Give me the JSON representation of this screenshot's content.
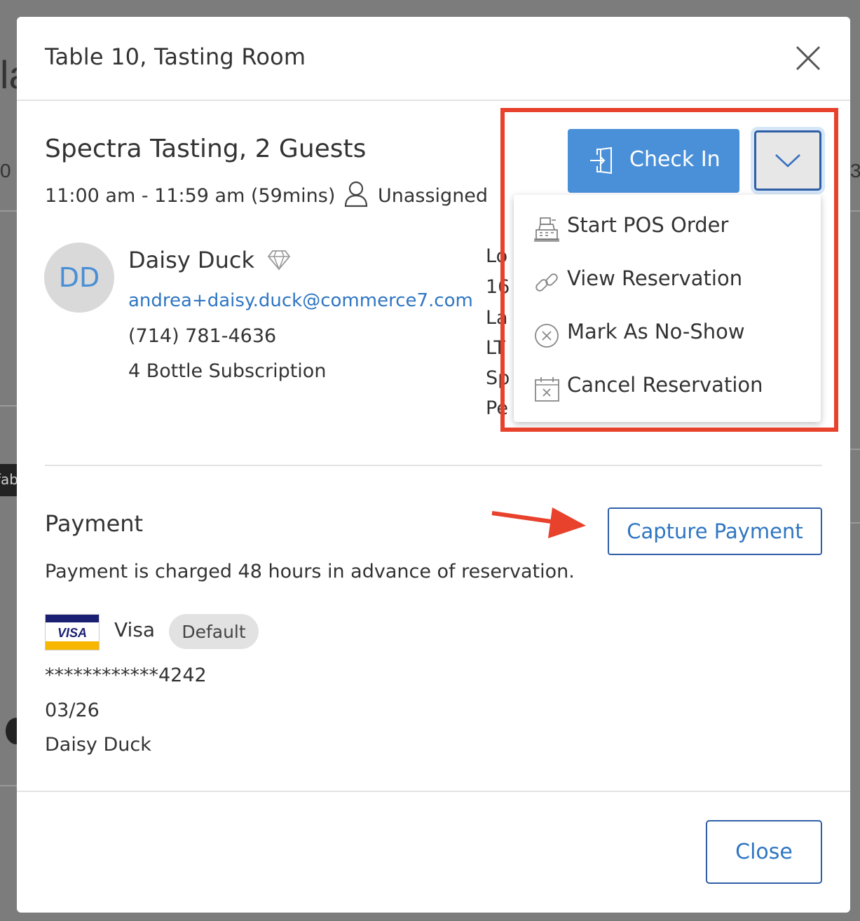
{
  "modal": {
    "title": "Table 10, Tasting Room"
  },
  "reservation": {
    "title": "Spectra Tasting, 2 Guests",
    "time": "11:00 am - 11:59 am (59mins)",
    "assignee": "Unassigned"
  },
  "customer": {
    "initials": "DD",
    "name": "Daisy Duck",
    "email": "andrea+daisy.duck@commerce7.com",
    "phone": "(714) 781-4636",
    "subscription": "4 Bottle Subscription",
    "side_fragments": [
      "Lo",
      "16",
      "La",
      "LT",
      "Sp",
      "Pe"
    ]
  },
  "actions": {
    "check_in_label": "Check In",
    "dropdown_items": [
      {
        "label": "Start POS Order",
        "icon": "cash-register-icon"
      },
      {
        "label": "View Reservation",
        "icon": "link-icon"
      },
      {
        "label": "Mark As No-Show",
        "icon": "x-circle-icon"
      },
      {
        "label": "Cancel Reservation",
        "icon": "calendar-x-icon"
      }
    ]
  },
  "payment": {
    "title": "Payment",
    "capture_label": "Capture Payment",
    "note": "Payment is charged 48 hours in advance of reservation.",
    "card_brand_logo": "VISA",
    "card_brand": "Visa",
    "default_badge": "Default",
    "card_number": "************4242",
    "expiry": "03/26",
    "holder": "Daisy Duck"
  },
  "footer": {
    "close_label": "Close"
  },
  "background": {
    "frag_left": "la",
    "frag_tab": "fab",
    "frag_zero": "0",
    "frag_right": "3"
  },
  "colors": {
    "primary": "#4a90d9",
    "link": "#2f76c2",
    "annotation": "#e8412c",
    "avatar_bg": "#d9d9d9"
  }
}
